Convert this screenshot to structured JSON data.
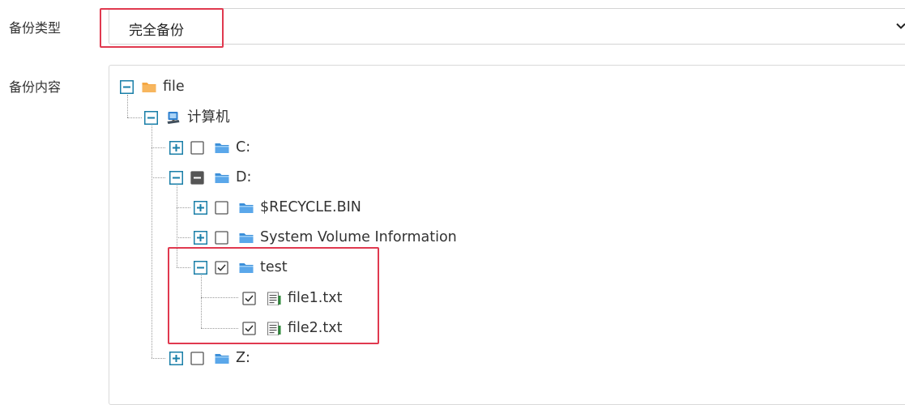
{
  "form": {
    "backup_type_label": "备份类型",
    "backup_content_label": "备份内容"
  },
  "select": {
    "value": "完全备份"
  },
  "tree": {
    "root": {
      "label": "file",
      "state": "expanded"
    },
    "computer": {
      "label": "计算机",
      "state": "expanded"
    },
    "drives": [
      {
        "label": "C:",
        "state": "collapsed",
        "check": "unchecked"
      },
      {
        "label": "D:",
        "state": "expanded",
        "check": "partial"
      },
      {
        "label": "Z:",
        "state": "collapsed",
        "check": "unchecked"
      }
    ],
    "d_children": [
      {
        "label": "$RECYCLE.BIN",
        "state": "collapsed",
        "check": "unchecked"
      },
      {
        "label": "System Volume Information",
        "state": "collapsed",
        "check": "unchecked"
      },
      {
        "label": "test",
        "state": "expanded",
        "check": "checked"
      }
    ],
    "test_children": [
      {
        "label": "file1.txt",
        "check": "checked"
      },
      {
        "label": "file2.txt",
        "check": "checked"
      }
    ]
  },
  "colors": {
    "highlight": "#e0394f",
    "expander": "#1a7fa8",
    "folder": "#3b8fd9",
    "root_folder": "#f5a742"
  },
  "icons": [
    "chevron-down-icon",
    "collapse-icon",
    "expand-icon",
    "folder-icon",
    "computer-icon",
    "text-file-icon",
    "checkbox"
  ]
}
